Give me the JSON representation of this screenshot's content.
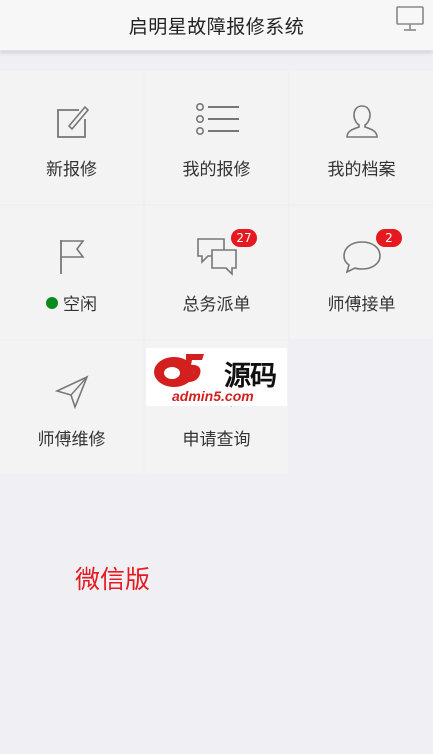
{
  "header": {
    "title": "启明星故障报修系统",
    "right_icon": "monitor-icon"
  },
  "menu": {
    "items": [
      {
        "label": "新报修",
        "icon": "edit-icon"
      },
      {
        "label": "我的报修",
        "icon": "list-icon"
      },
      {
        "label": "我的档案",
        "icon": "user-icon"
      },
      {
        "label": "空闲",
        "icon": "flag-icon",
        "status_color": "#0a8a1f"
      },
      {
        "label": "总务派单",
        "icon": "chat-bubbles-icon",
        "badge": "27"
      },
      {
        "label": "师傅接单",
        "icon": "chat-bubble-icon",
        "badge": "2"
      },
      {
        "label": "师傅维修",
        "icon": "send-icon"
      },
      {
        "label": "申请查询",
        "icon": "search-icon"
      }
    ]
  },
  "watermark": {
    "brand_cn": "源码",
    "brand_url": "admin5.com"
  },
  "footer": {
    "version_text": "微信版"
  },
  "colors": {
    "accent": "#e5191f",
    "status_idle": "#0a8a1f",
    "icon": "#777777"
  }
}
